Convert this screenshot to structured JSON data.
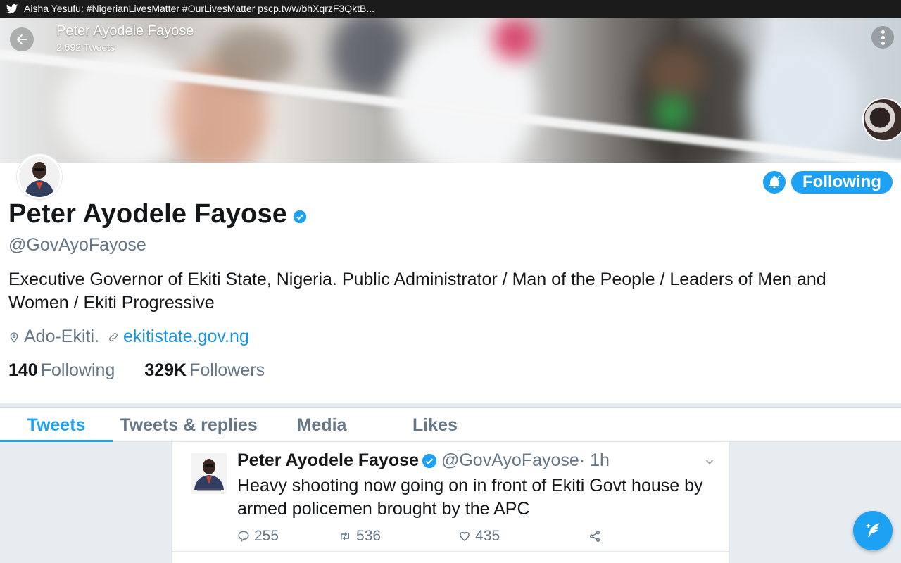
{
  "notification": {
    "icon": "twitter-bird-icon",
    "text": "Aisha Yesufu: #NigerianLivesMatter #OurLivesMatter pscp.tv/w/bhXqrzF3QktB..."
  },
  "header": {
    "name": "Peter Ayodele Fayose",
    "tweet_count": "2,692 Tweets"
  },
  "profile": {
    "name": "Peter Ayodele Fayose",
    "handle": "@GovAyoFayose",
    "bio": "Executive Governor of Ekiti State, Nigeria. Public Administrator / Man of the People / Leaders of Men and Women / Ekiti Progressive",
    "location": "Ado-Ekiti.",
    "website": "ekitistate.gov.ng",
    "following_count": "140",
    "following_label": "Following",
    "followers_count": "329K",
    "followers_label": "Followers",
    "follow_button_label": "Following",
    "verified": true
  },
  "tabs": [
    {
      "label": "Tweets",
      "active": true
    },
    {
      "label": "Tweets & replies",
      "active": false
    },
    {
      "label": "Media",
      "active": false
    },
    {
      "label": "Likes",
      "active": false
    }
  ],
  "tweet": {
    "name": "Peter Ayodele Fayose",
    "handle": "@GovAyoFayose",
    "time": " · 1h",
    "text": "Heavy shooting now going on in front of Ekiti Govt house by armed policemen brought by the APC",
    "replies": "255",
    "retweets": "536",
    "likes": "435"
  },
  "colors": {
    "accent": "#1da1f2",
    "link": "#1b95e0",
    "muted": "#657786",
    "background": "#e6ecf0"
  }
}
